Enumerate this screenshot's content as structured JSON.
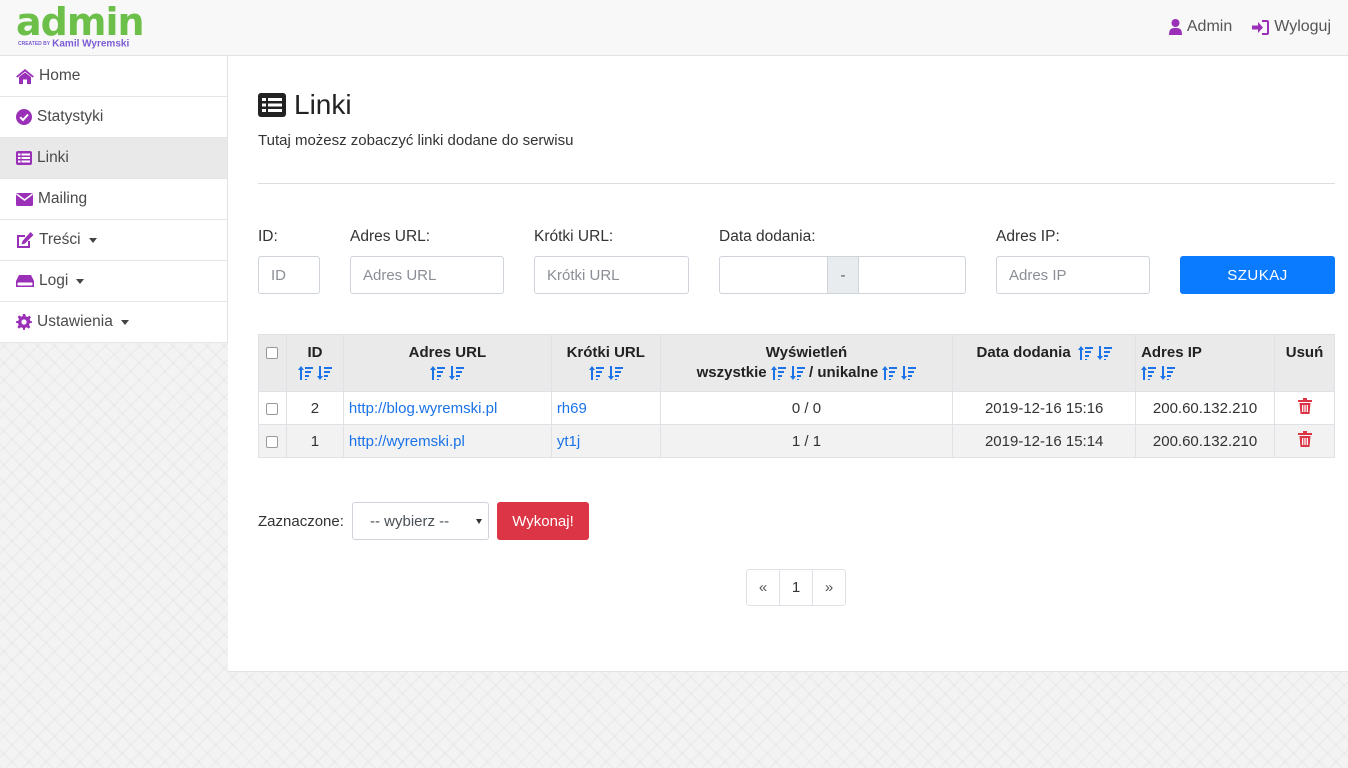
{
  "brand": {
    "logo": "admin",
    "created_by": "CREATED BY",
    "author": "Kamil Wyremski"
  },
  "topnav": {
    "user": "Admin",
    "logout": "Wyloguj"
  },
  "sidebar": {
    "items": [
      {
        "label": "Home",
        "icon": "home-icon"
      },
      {
        "label": "Statystyki",
        "icon": "check-circle-icon"
      },
      {
        "label": "Linki",
        "icon": "list-icon",
        "active": true
      },
      {
        "label": "Mailing",
        "icon": "envelope-icon"
      },
      {
        "label": "Treści",
        "icon": "edit-icon",
        "dropdown": true
      },
      {
        "label": "Logi",
        "icon": "drive-icon",
        "dropdown": true
      },
      {
        "label": "Ustawienia",
        "icon": "gear-icon",
        "dropdown": true
      }
    ]
  },
  "page": {
    "title": "Linki",
    "subtitle": "Tutaj możesz zobaczyć linki dodane do serwisu"
  },
  "filters": {
    "id_label": "ID:",
    "id_placeholder": "ID",
    "url_label": "Adres URL:",
    "url_placeholder": "Adres URL",
    "short_label": "Krótki URL:",
    "short_placeholder": "Krótki URL",
    "date_label": "Data dodania:",
    "date_separator": "-",
    "ip_label": "Adres IP:",
    "ip_placeholder": "Adres IP",
    "search_button": "SZUKAJ"
  },
  "table": {
    "headers": {
      "id": "ID",
      "url": "Adres URL",
      "short": "Krótki URL",
      "views": "Wyświetleń",
      "views_all": "wszystkie",
      "views_sep": "/",
      "views_unique": "unikalne",
      "date": "Data dodania",
      "ip": "Adres IP",
      "delete": "Usuń"
    },
    "rows": [
      {
        "id": "2",
        "url": "http://blog.wyremski.pl",
        "short": "rh69",
        "views": "0 / 0",
        "date": "2019-12-16 15:16",
        "ip": "200.60.132.210"
      },
      {
        "id": "1",
        "url": "http://wyremski.pl",
        "short": "yt1j",
        "views": "1 / 1",
        "date": "2019-12-16 15:14",
        "ip": "200.60.132.210"
      }
    ]
  },
  "bulk": {
    "label": "Zaznaczone:",
    "select_value": "-- wybierz --",
    "execute_button": "Wykonaj!"
  },
  "pagination": {
    "prev": "«",
    "current": "1",
    "next": "»"
  },
  "colors": {
    "brand_green": "#6cc04a",
    "icon_purple": "#9b30b8",
    "primary": "#0a7bff",
    "danger": "#dc3545",
    "link": "#1a73e8"
  }
}
